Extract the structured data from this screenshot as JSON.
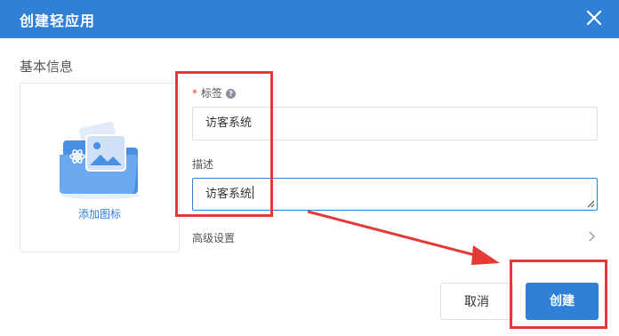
{
  "dialog": {
    "title": "创建轻应用"
  },
  "section": {
    "title": "基本信息"
  },
  "icon_card": {
    "add_label": "添加图标",
    "illustration": "folder-image-illustration"
  },
  "form": {
    "tag": {
      "required_mark": "*",
      "label": "标签",
      "value": "访客系统",
      "help_icon": "question-circle-icon"
    },
    "description": {
      "label": "描述",
      "value": "访客系统"
    },
    "advanced": {
      "label": "高级设置",
      "icon": "chevron-right-icon"
    }
  },
  "buttons": {
    "cancel": "取消",
    "create": "创建"
  },
  "colors": {
    "primary": "#2f81d8",
    "annotation": "#e53935"
  }
}
